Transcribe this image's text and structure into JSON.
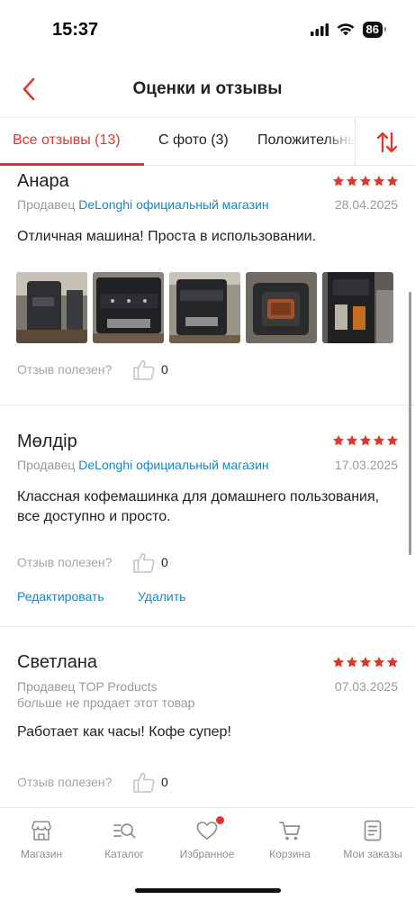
{
  "status_bar": {
    "time": "15:37",
    "battery": "86"
  },
  "header": {
    "title": "Оценки и отзывы"
  },
  "tabs": [
    {
      "label": "Все отзывы (13)",
      "active": true
    },
    {
      "label": "С фото (3)",
      "active": false
    },
    {
      "label": "Положительные",
      "active": false
    }
  ],
  "helpful_label": "Отзыв полезен?",
  "reviews": [
    {
      "name": "Анара",
      "rating": 5,
      "seller_prefix": "Продавец",
      "seller_name": "DeLonghi официальный магазин",
      "date": "28.04.2025",
      "text": "Отличная машина! Проста в использовании.",
      "photo_count": 5,
      "likes": "0"
    },
    {
      "name": "Мөлдір",
      "rating": 5,
      "seller_prefix": "Продавец",
      "seller_name": "DeLonghi официальный магазин",
      "date": "17.03.2025",
      "text": "Классная кофемашинка для домашнего пользования, все доступно и просто.",
      "likes": "0",
      "edit_label": "Редактировать",
      "delete_label": "Удалить"
    },
    {
      "name": "Светлана",
      "rating": 5,
      "seller_prefix": "Продавец",
      "seller_name": "TOP Products",
      "seller_note": "больше не продает этот товар",
      "date": "07.03.2025",
      "text": "Работает как часы! Кофе супер!",
      "likes": "0"
    }
  ],
  "bottom_nav": [
    {
      "label": "Магазин",
      "icon": "store-icon"
    },
    {
      "label": "Каталог",
      "icon": "catalog-search-icon"
    },
    {
      "label": "Избранное",
      "icon": "heart-icon",
      "badge": true
    },
    {
      "label": "Корзина",
      "icon": "cart-icon"
    },
    {
      "label": "Мои заказы",
      "icon": "orders-icon"
    }
  ],
  "colors": {
    "accent": "#e0372c",
    "link": "#1a87c4",
    "muted": "#9a9a9a"
  }
}
